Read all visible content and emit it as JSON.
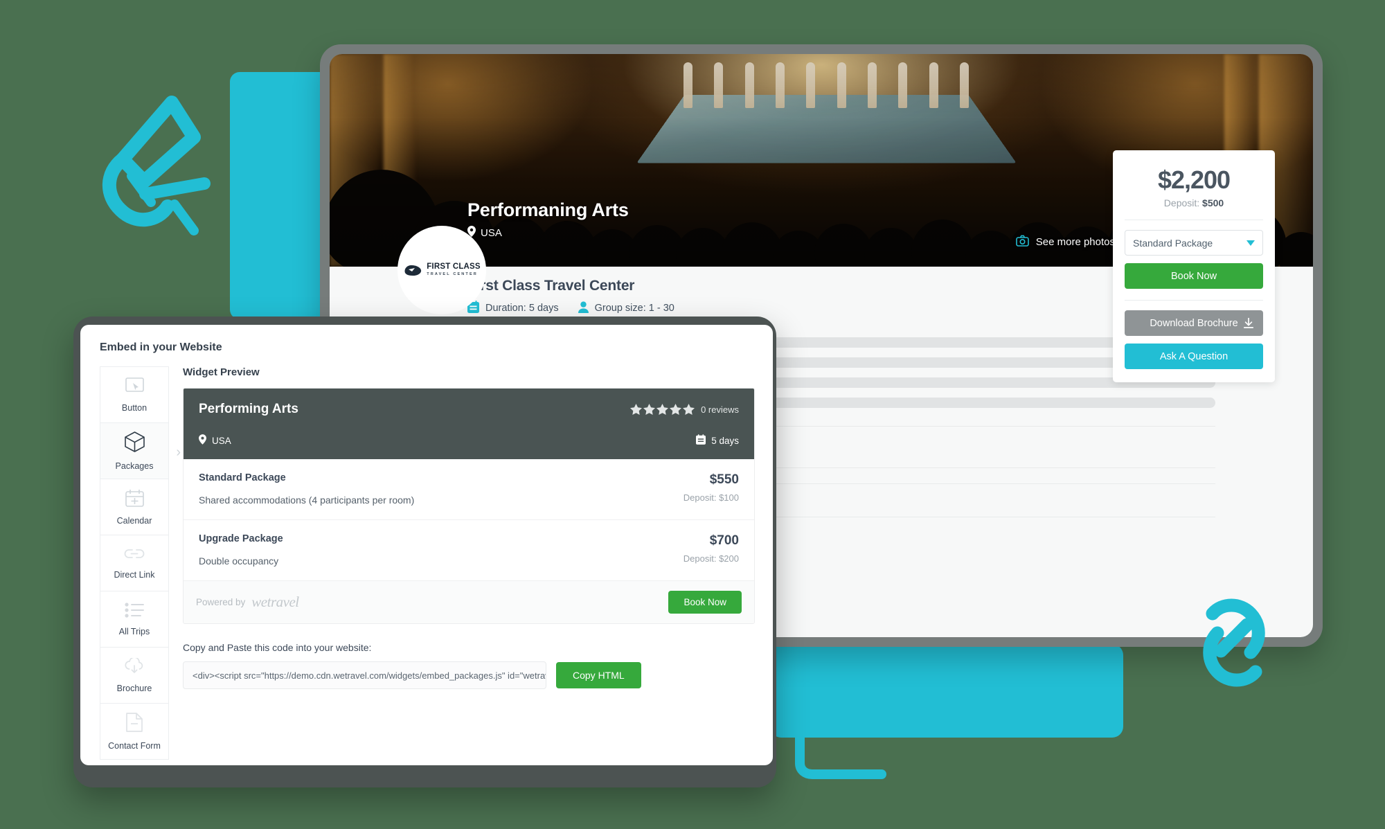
{
  "theme": {
    "background": "#4a7050",
    "accent_teal": "#22bed4",
    "accent_green": "#36a93c",
    "dark_slate": "#4a5453",
    "grey_button": "#8f9496"
  },
  "trip_page": {
    "hero": {
      "title": "Performaning Arts",
      "location": "USA",
      "see_more_photos": "See more photos",
      "location_icon": "map-pin-icon",
      "camera_icon": "camera-icon"
    },
    "organizer": {
      "name": "First Class Travel Center",
      "logo_line1": "FIRST CLASS",
      "logo_line2": "TRAVEL CENTER",
      "duration": "Duration: 5 days",
      "group_size": "Group size: 1 - 30",
      "duration_icon": "calendar-icon",
      "group_icon": "person-icon"
    },
    "booking": {
      "price": "$2,200",
      "deposit_label": "Deposit:",
      "deposit_value": "$500",
      "package_selected": "Standard Package",
      "package_options": [
        "Standard Package",
        "Upgrade Package"
      ],
      "book_now": "Book Now",
      "download_brochure": "Download Brochure",
      "ask_question": "Ask A Question",
      "download_icon": "download-icon",
      "caret_icon": "chevron-down-icon"
    }
  },
  "embed_modal": {
    "title": "Embed in your Website",
    "sidebar": [
      {
        "label": "Button",
        "icon": "cursor-in-frame-icon",
        "active": false
      },
      {
        "label": "Packages",
        "icon": "box-icon",
        "active": true
      },
      {
        "label": "Calendar",
        "icon": "calendar-icon",
        "active": false
      },
      {
        "label": "Direct Link",
        "icon": "link-icon",
        "active": false
      },
      {
        "label": "All Trips",
        "icon": "bullet-list-icon",
        "active": false
      },
      {
        "label": "Brochure",
        "icon": "cloud-download-icon",
        "active": false
      },
      {
        "label": "Contact Form",
        "icon": "document-icon",
        "active": false
      }
    ],
    "preview_label": "Widget Preview",
    "widget": {
      "name": "Performing Arts",
      "star_count": 5,
      "reviews": "0 reviews",
      "location": "USA",
      "duration": "5 days",
      "location_icon": "map-pin-icon",
      "duration_icon": "calendar-icon",
      "packages": [
        {
          "name": "Standard Package",
          "description": "Shared accommodations (4 participants per room)",
          "price": "$550",
          "deposit": "Deposit: $100"
        },
        {
          "name": "Upgrade Package",
          "description": "Double occupancy",
          "price": "$700",
          "deposit": "Deposit: $200"
        }
      ],
      "powered_by": "Powered by",
      "powered_brand": "wetravel",
      "book_now": "Book Now"
    },
    "copy_label": "Copy and Paste this code into your website:",
    "code_snippet": "<div><script src=\"https://demo.cdn.wetravel.com/widgets/embed_packages.js\" id=\"wetravel_p",
    "copy_button": "Copy HTML"
  },
  "decorations": {
    "megaphone_icon": "megaphone-icon",
    "link_icon": "chain-link-icon",
    "chat_bubble": "speech-bubble-shape"
  }
}
